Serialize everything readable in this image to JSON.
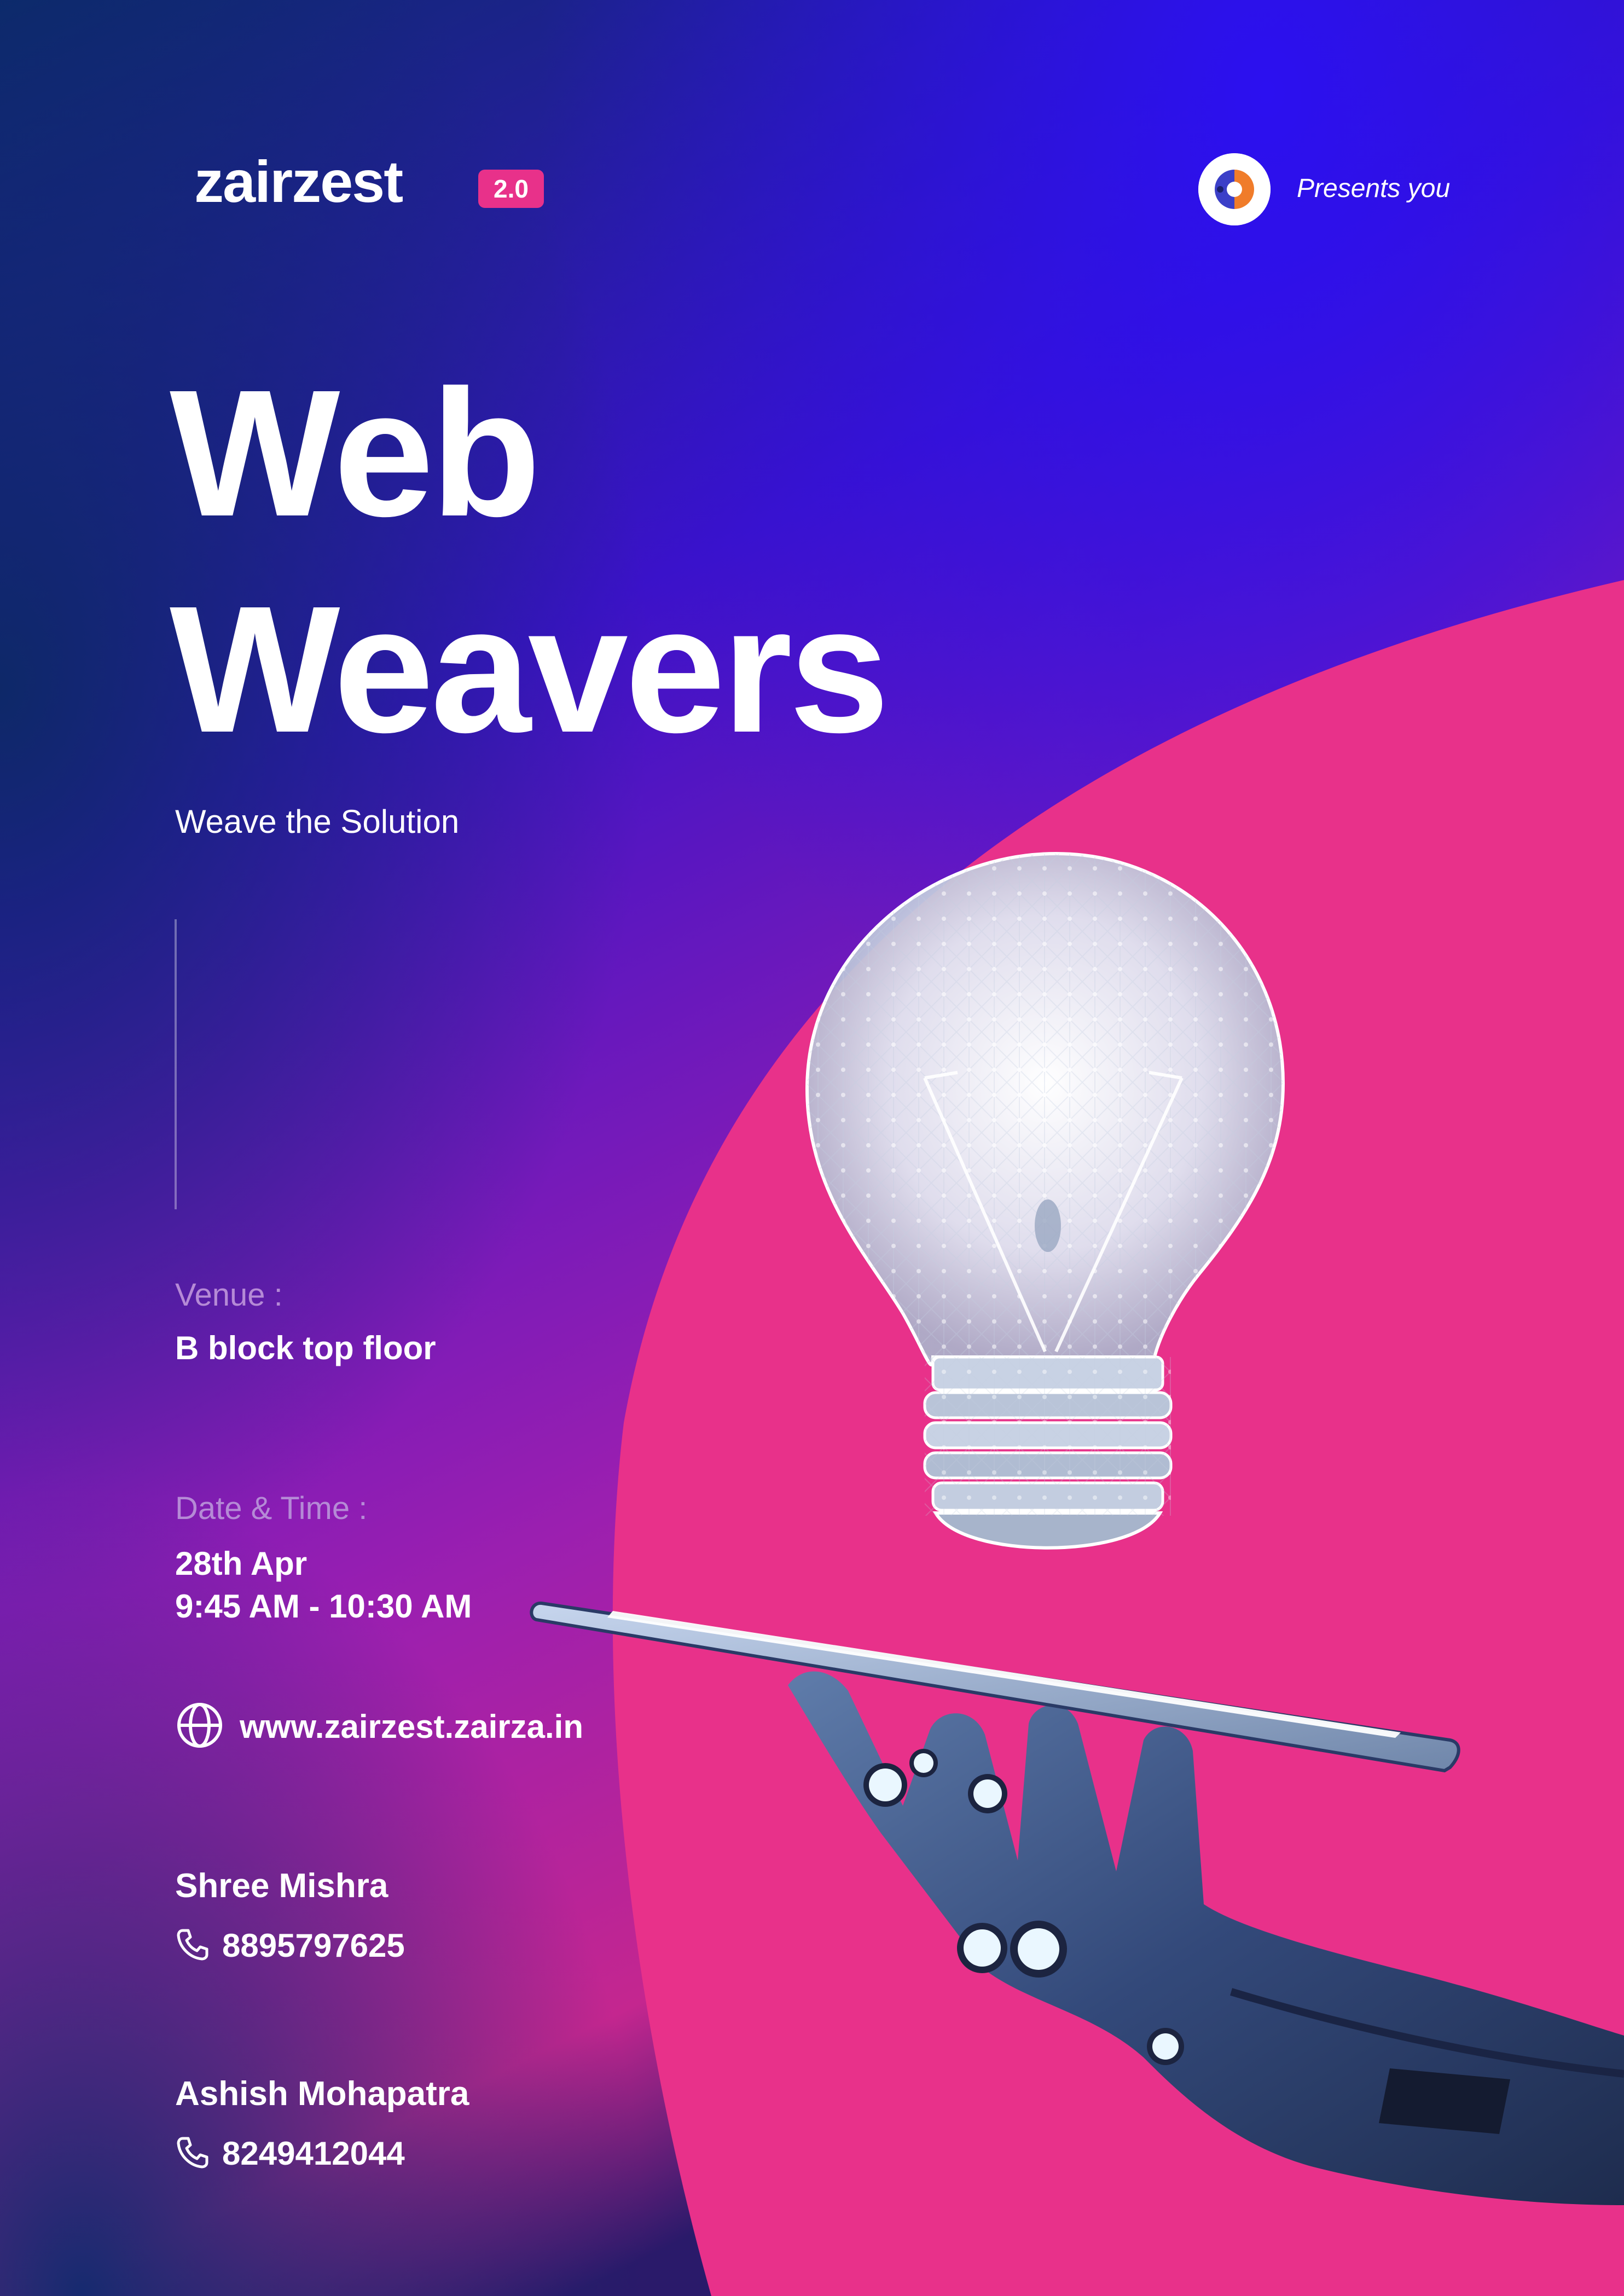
{
  "brand": {
    "name": "zairzest",
    "badge": "2.0",
    "presents_label": "Presents you"
  },
  "event": {
    "title_line1": "Web",
    "title_line2": "Weavers",
    "tagline": "Weave the Solution"
  },
  "venue": {
    "label": "Venue :",
    "value": "B block top floor"
  },
  "datetime": {
    "label": "Date & Time :",
    "date": "28th Apr",
    "time": "9:45 AM - 10:30 AM"
  },
  "website": "www.zairzest.zairza.in",
  "contacts": [
    {
      "name": "Shree Mishra",
      "phone": "8895797625"
    },
    {
      "name": "Ashish Mohapatra",
      "phone": "8249412044"
    }
  ],
  "icons": {
    "globe": "globe-icon",
    "phone": "phone-icon",
    "partner_logo": "partner-logo-icon",
    "hero": "lightbulb-on-tablet-robot-hand-illustration"
  },
  "colors": {
    "background_blue": "#1a0f9e",
    "accent_pink": "#e8318a",
    "label_muted": "#b58ad6",
    "white": "#ffffff",
    "logo_orange": "#f07c2a",
    "logo_blue": "#3b3fc8"
  }
}
